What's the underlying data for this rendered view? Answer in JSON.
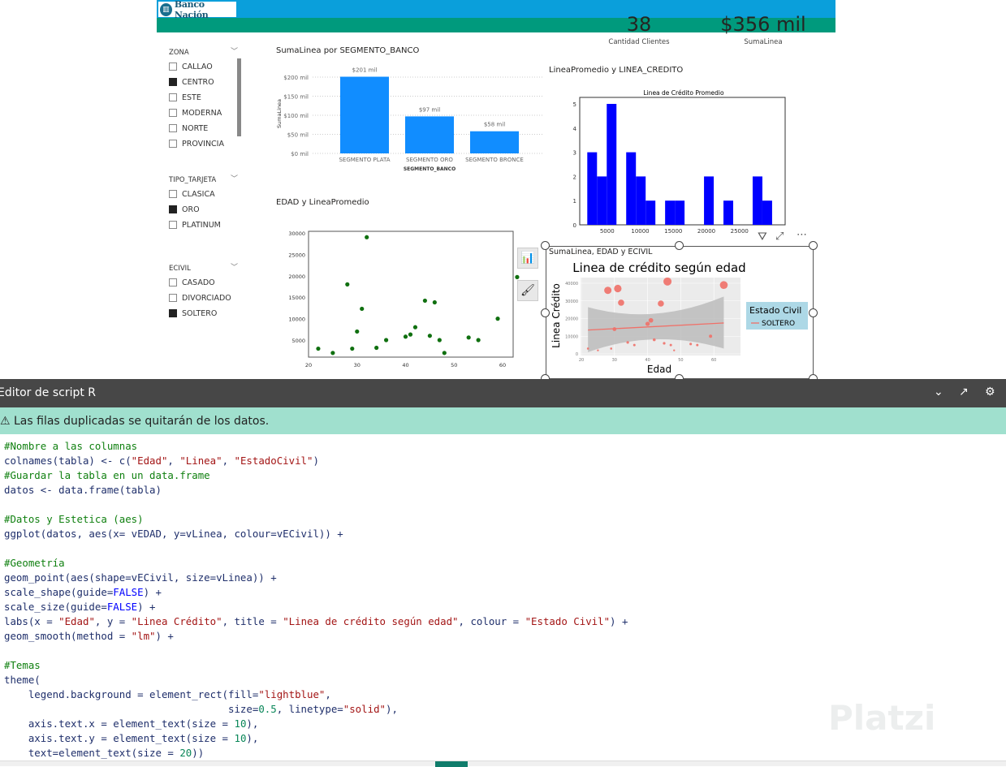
{
  "header": {
    "brand": "Banco Nación",
    "brand_icon": "bank-building-icon",
    "colors": {
      "top": "#0a9fdb",
      "green": "#009a7d"
    }
  },
  "kpis": [
    {
      "value": "38",
      "label": "Cantidad Clientes"
    },
    {
      "value": "$356 mil",
      "label": "SumaLinea"
    }
  ],
  "slicers": [
    {
      "title": "ZONA",
      "items": [
        {
          "label": "CALLAO",
          "checked": false
        },
        {
          "label": "CENTRO",
          "checked": true
        },
        {
          "label": "ESTE",
          "checked": false
        },
        {
          "label": "MODERNA",
          "checked": false
        },
        {
          "label": "NORTE",
          "checked": false
        },
        {
          "label": "PROVINCIA",
          "checked": false
        }
      ]
    },
    {
      "title": "TIPO_TARJETA",
      "items": [
        {
          "label": "CLASICA",
          "checked": false
        },
        {
          "label": "ORO",
          "checked": true
        },
        {
          "label": "PLATINUM",
          "checked": false
        }
      ]
    },
    {
      "title": "ECIVIL",
      "items": [
        {
          "label": "CASADO",
          "checked": false
        },
        {
          "label": "DIVORCIADO",
          "checked": false
        },
        {
          "label": "SOLTERO",
          "checked": true
        }
      ]
    }
  ],
  "visual_titles": {
    "bar": "SumaLinea por SEGMENTO_BANCO",
    "hist": "LineaPromedio y LINEA_CREDITO",
    "scatter": "EDAD y LineaPromedio",
    "ggplot": "SumaLinea, EDAD y ECIVIL"
  },
  "chart_data": [
    {
      "type": "bar",
      "title": "",
      "categories": [
        "SEGMENTO PLATA",
        "SEGMENTO ORO",
        "SEGMENTO BRONCE"
      ],
      "values": [
        201,
        97,
        58
      ],
      "data_labels": [
        "$201 mil",
        "$97 mil",
        "$58 mil"
      ],
      "xlabel": "SEGMENTO_BANCO",
      "ylabel": "SumaLinea",
      "yticks": [
        {
          "v": 0,
          "label": "$0 mil"
        },
        {
          "v": 50,
          "label": "$50 mil"
        },
        {
          "v": 100,
          "label": "$100 mil"
        },
        {
          "v": 150,
          "label": "$150 mil"
        },
        {
          "v": 200,
          "label": "$200 mil"
        }
      ],
      "ylim": [
        0,
        200
      ],
      "grid": true,
      "color": "#118dff"
    },
    {
      "type": "bar",
      "title": "Linea de Crédito Promedio",
      "bin_start": 2000,
      "bin_width": 1470,
      "counts": [
        3,
        2,
        5,
        0,
        3,
        2,
        1,
        0,
        1,
        1,
        0,
        0,
        2,
        0,
        1,
        0,
        0,
        2,
        1
      ],
      "xticks": [
        5000,
        10000,
        15000,
        20000,
        25000
      ],
      "yticks": [
        0,
        1,
        2,
        3,
        4,
        5
      ],
      "ylim": [
        0,
        5.3
      ],
      "color": "#0000ff"
    },
    {
      "type": "scatter",
      "title": "",
      "x": [
        22,
        25,
        28,
        29,
        30,
        31,
        32,
        34,
        36,
        40,
        41,
        42,
        44,
        45,
        46,
        47,
        48,
        53,
        55,
        59,
        63
      ],
      "y": [
        3000,
        2000,
        18000,
        3000,
        7000,
        12300,
        29000,
        3200,
        5000,
        5800,
        6300,
        8000,
        14200,
        6000,
        13800,
        5000,
        2000,
        5600,
        5000,
        10000,
        19700
      ],
      "xticks": [
        20,
        30,
        40,
        50,
        60
      ],
      "yticks": [
        5000,
        10000,
        15000,
        20000,
        25000,
        30000
      ],
      "xlim": [
        20,
        65
      ],
      "ylim": [
        1000,
        30300
      ],
      "color": "#107010"
    },
    {
      "type": "scatter",
      "title": "Linea de crédito según edad",
      "xlabel": "Edad",
      "ylabel": "Linea Crédito",
      "x": [
        22,
        25,
        28,
        29,
        30,
        31,
        32,
        34,
        36,
        40,
        41,
        42,
        44,
        45,
        46,
        47,
        48,
        53,
        55,
        59,
        63
      ],
      "y": [
        3000,
        2000,
        36000,
        3000,
        14000,
        37000,
        29000,
        6500,
        5000,
        17000,
        19000,
        8000,
        28500,
        6000,
        41000,
        5000,
        2000,
        5600,
        5000,
        10000,
        39000
      ],
      "xticks": [
        20,
        30,
        40,
        50,
        60
      ],
      "yticks": [
        0,
        10000,
        20000,
        30000,
        40000
      ],
      "xlim": [
        19.8,
        65.5
      ],
      "ylim": [
        -500,
        44000
      ],
      "trend": {
        "x": [
          22,
          63
        ],
        "y": [
          13500,
          17500
        ]
      },
      "legend": {
        "title": "Estado Civil",
        "entries": [
          "SOLTERO"
        ],
        "placement": "right",
        "background": "#add8e6"
      },
      "color": "#f07068"
    }
  ],
  "editor": {
    "title": "Editor de script R",
    "warning": "⚠ Las filas duplicadas se quitarán de los datos.",
    "code": [
      "#Nombre a las columnas",
      "colnames(tabla) <- c(\"Edad\", \"Linea\", \"EstadoCivil\")",
      "#Guardar la tabla en un data.frame",
      "datos <- data.frame(tabla)",
      "",
      "#Datos y Estetica (aes)",
      "ggplot(datos, aes(x= vEDAD, y=vLinea, colour=vECivil)) +",
      "",
      "#Geometría",
      "geom_point(aes(shape=vECivil, size=vLinea)) +",
      "scale_shape(guide=FALSE) +",
      "scale_size(guide=FALSE) +",
      "labs(x = \"Edad\", y = \"Linea Crédito\", title = \"Linea de crédito según edad\", colour = \"Estado Civil\") +",
      "geom_smooth(method = \"lm\") +",
      "",
      "#Temas",
      "theme(",
      "    legend.background = element_rect(fill=\"lightblue\",",
      "                                     size=0.5, linetype=\"solid\"),",
      "    axis.text.x = element_text(size = 10),",
      "    axis.text.y = element_text(size = 10),",
      "    text=element_text(size = 20))"
    ]
  },
  "watermark": "Platzi"
}
